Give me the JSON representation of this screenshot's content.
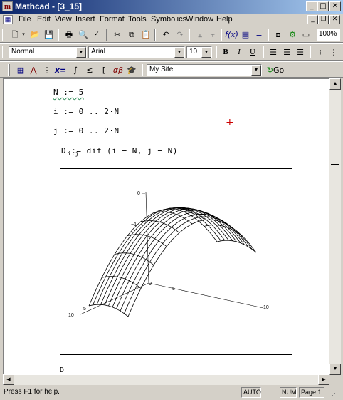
{
  "window": {
    "title": "Mathcad - [3_15]",
    "app_icon_glyph": "m",
    "minimize_glyph": "_",
    "maximize_glyph": "□",
    "close_glyph": "✕"
  },
  "menu": {
    "items": [
      "File",
      "Edit",
      "View",
      "Insert",
      "Format",
      "Tools",
      "Symbolics",
      "Window",
      "Help"
    ],
    "doc_minimize_glyph": "_",
    "doc_restore_glyph": "❐",
    "doc_close_glyph": "✕"
  },
  "standard_toolbar": {
    "icons": [
      "new-icon",
      "open-icon",
      "save-icon",
      "print-icon",
      "print-preview-icon",
      "spell-check-icon",
      "cut-icon",
      "copy-icon",
      "paste-icon",
      "undo-icon",
      "redo-icon",
      "align-across-icon",
      "align-down-icon",
      "insert-function-icon",
      "insert-unit-icon",
      "calculate-icon",
      "component-icon",
      "resources-icon",
      "insert-component-icon"
    ],
    "zoom": "100%"
  },
  "format_toolbar": {
    "style": "Normal",
    "font": "Arial",
    "size": "10",
    "bold_label": "B",
    "italic_label": "I",
    "underline_label": "U"
  },
  "math_toolbar": {
    "resources": "My Site",
    "go_label": "Go"
  },
  "worksheet": {
    "line1": "N := 5",
    "line2": "i := 0 .. 2·N",
    "line3": "j := 0 .. 2·N",
    "line4": "D  := dif (i − N, j − N)",
    "line4_subscript": "i,j",
    "surface_label": "D",
    "tick_z0": "0",
    "tick_z1": "−1",
    "tick_x10": "10",
    "tick_xa": "5",
    "tick_0": "0",
    "tick_5": "5",
    "tick_y10": "10"
  },
  "statusbar": {
    "help": "Press F1 for help.",
    "auto": "AUTO",
    "num": "NUM",
    "page": "Page 1"
  }
}
